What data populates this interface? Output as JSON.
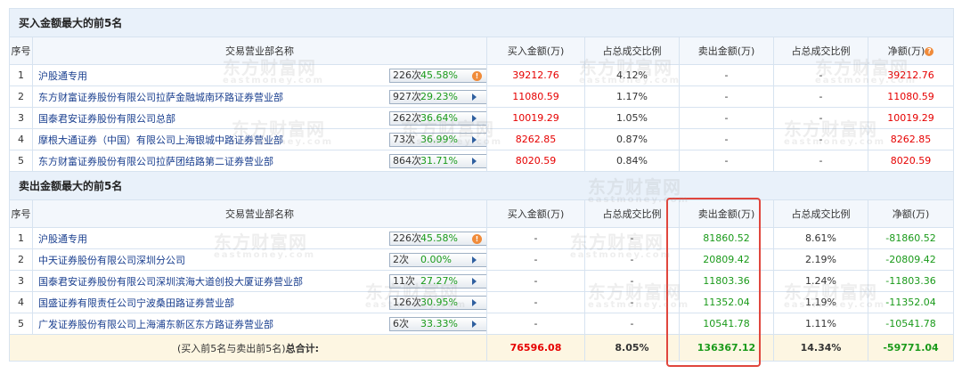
{
  "buy_section": {
    "title": "买入金额最大的前5名",
    "headers": [
      "序号",
      "交易营业部名称",
      "买入金额(万)",
      "占总成交比例",
      "卖出金额(万)",
      "占总成交比例",
      "净额(万)"
    ],
    "net_info_icon": "info-icon",
    "rows": [
      {
        "idx": "1",
        "name": "沪股通专用",
        "count": "226次",
        "pct": "45.58%",
        "icon": "info-dot-icon",
        "buy": "39212.76",
        "buy_ratio": "4.12%",
        "sell": "-",
        "sell_ratio": "-",
        "net": "39212.76"
      },
      {
        "idx": "2",
        "name": "东方财富证券股份有限公司拉萨金融城南环路证券营业部",
        "count": "927次",
        "pct": "29.23%",
        "icon": "arrow-right-icon",
        "buy": "11080.59",
        "buy_ratio": "1.17%",
        "sell": "-",
        "sell_ratio": "-",
        "net": "11080.59"
      },
      {
        "idx": "3",
        "name": "国泰君安证券股份有限公司总部",
        "count": "262次",
        "pct": "36.64%",
        "icon": "arrow-right-icon",
        "buy": "10019.29",
        "buy_ratio": "1.05%",
        "sell": "-",
        "sell_ratio": "-",
        "net": "10019.29"
      },
      {
        "idx": "4",
        "name": "摩根大通证券（中国）有限公司上海银城中路证券营业部",
        "count": "73次",
        "pct": "36.99%",
        "icon": "arrow-right-icon",
        "buy": "8262.85",
        "buy_ratio": "0.87%",
        "sell": "-",
        "sell_ratio": "-",
        "net": "8262.85"
      },
      {
        "idx": "5",
        "name": "东方财富证券股份有限公司拉萨团结路第二证券营业部",
        "count": "864次",
        "pct": "31.71%",
        "icon": "arrow-right-icon",
        "buy": "8020.59",
        "buy_ratio": "0.84%",
        "sell": "-",
        "sell_ratio": "-",
        "net": "8020.59"
      }
    ]
  },
  "sell_section": {
    "title": "卖出金额最大的前5名",
    "headers": [
      "序号",
      "交易营业部名称",
      "买入金额(万)",
      "占总成交比例",
      "卖出金额(万)",
      "占总成交比例",
      "净额(万)"
    ],
    "rows": [
      {
        "idx": "1",
        "name": "沪股通专用",
        "count": "226次",
        "pct": "45.58%",
        "icon": "info-dot-icon",
        "buy": "-",
        "buy_ratio": "-",
        "sell": "81860.52",
        "sell_ratio": "8.61%",
        "net": "-81860.52"
      },
      {
        "idx": "2",
        "name": "中天证券股份有限公司深圳分公司",
        "count": "2次",
        "pct": "0.00%",
        "icon": "arrow-right-icon",
        "buy": "-",
        "buy_ratio": "-",
        "sell": "20809.42",
        "sell_ratio": "2.19%",
        "net": "-20809.42"
      },
      {
        "idx": "3",
        "name": "国泰君安证券股份有限公司深圳滨海大道创投大厦证券营业部",
        "count": "11次",
        "pct": "27.27%",
        "icon": "arrow-right-icon",
        "buy": "-",
        "buy_ratio": "-",
        "sell": "11803.36",
        "sell_ratio": "1.24%",
        "net": "-11803.36"
      },
      {
        "idx": "4",
        "name": "国盛证券有限责任公司宁波桑田路证券营业部",
        "count": "126次",
        "pct": "30.95%",
        "icon": "arrow-right-icon",
        "buy": "-",
        "buy_ratio": "-",
        "sell": "11352.04",
        "sell_ratio": "1.19%",
        "net": "-11352.04"
      },
      {
        "idx": "5",
        "name": "广发证券股份有限公司上海浦东新区东方路证券营业部",
        "count": "6次",
        "pct": "33.33%",
        "icon": "arrow-right-icon",
        "buy": "-",
        "buy_ratio": "-",
        "sell": "10541.78",
        "sell_ratio": "1.11%",
        "net": "-10541.78"
      }
    ]
  },
  "total": {
    "label_prefix": "(买入前5名与卖出前5名)",
    "label_bold": "总合计:",
    "buy": "76596.08",
    "buy_ratio": "8.05%",
    "sell": "136367.12",
    "sell_ratio": "14.34%",
    "net": "-59771.04"
  },
  "watermark": {
    "cn": "东方财富网",
    "en": "eastmoney.com"
  },
  "colors": {
    "header_bg": "#e9f1fa",
    "positive": "#e60000",
    "negative": "#1a9a1a",
    "highlight": "#e0463d",
    "total_bg": "#fdf6e2"
  }
}
